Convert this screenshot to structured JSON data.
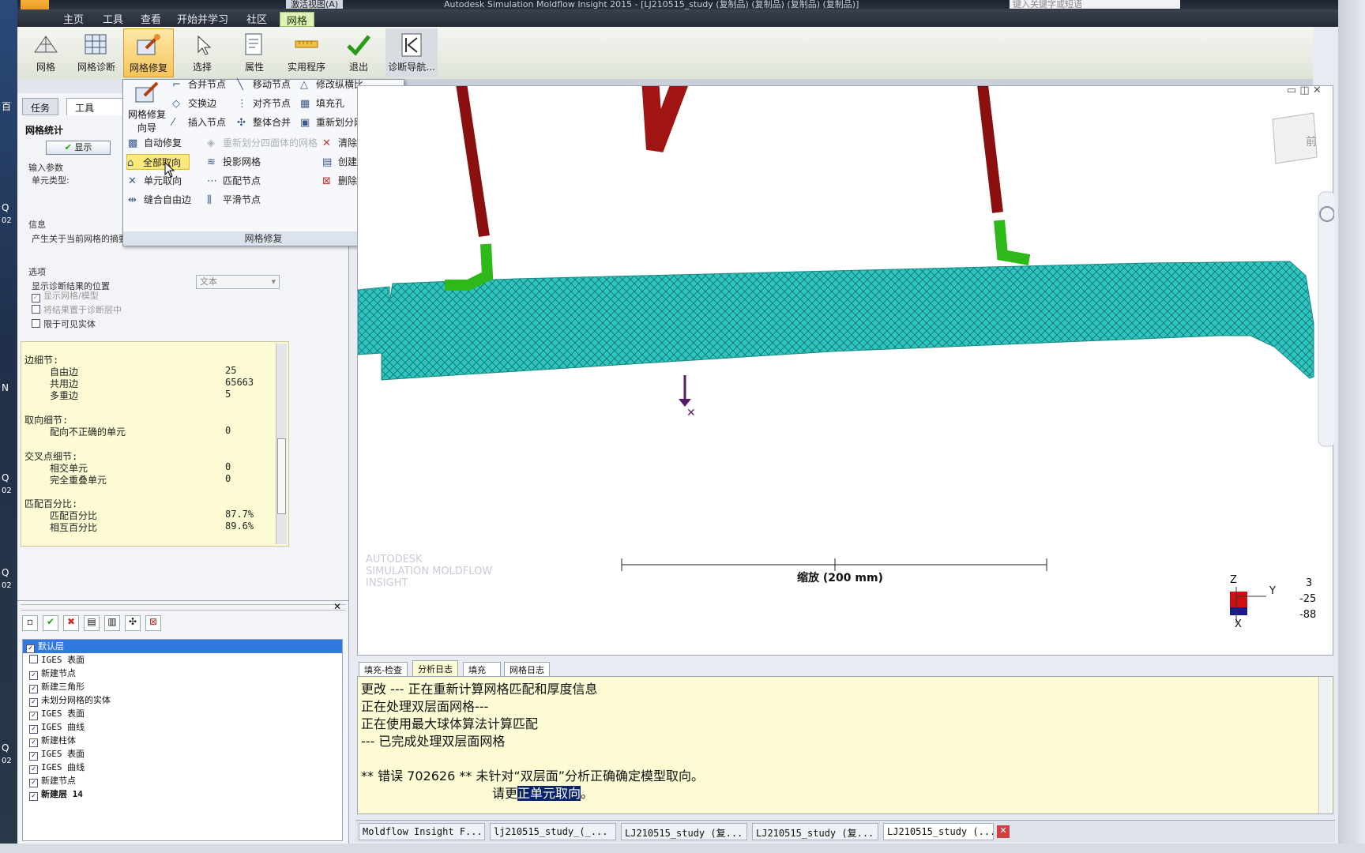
{
  "window": {
    "title": "Autodesk Simulation Moldflow Insight 2015 - [LJ210515_study (复制品) (复制品) (复制品) (复制品)]",
    "view_dropdown": "激活视图(A)",
    "search_placeholder": "键入关键字或短语"
  },
  "desktop_labels": [
    "百",
    "Q",
    "02",
    "N",
    "Q",
    "02",
    "Q",
    "02",
    "Q",
    "02"
  ],
  "menu": {
    "app_button": "MI",
    "items": [
      "主页",
      "工具",
      "查看",
      "开始并学习",
      "社区",
      "网格"
    ],
    "active": "网格"
  },
  "ribbon": {
    "buttons": [
      {
        "label": "网格",
        "icon": "mesh-icon"
      },
      {
        "label": "网格诊断",
        "icon": "mesh-diagnostic-icon"
      },
      {
        "label": "网格修复",
        "icon": "mesh-repair-icon",
        "selected": true
      },
      {
        "label": "选择",
        "icon": "cursor-select-icon"
      },
      {
        "label": "属性",
        "icon": "properties-icon"
      },
      {
        "label": "实用程序",
        "icon": "utilities-icon"
      },
      {
        "label": "退出",
        "icon": "checkmark-exit-icon"
      },
      {
        "label": "诊断导航...",
        "icon": "diagnostic-navigator-icon"
      }
    ]
  },
  "repair_menu": {
    "wizard_label_1": "网格修复",
    "wizard_label_2": "向导",
    "items": {
      "merge_nodes": "合并节点",
      "move_nodes": "移动节点",
      "modify_aspect": "修改纵横比",
      "swap_edge": "交换边",
      "align_nodes": "对齐节点",
      "fill_hole": "填充孔",
      "insert_node": "插入节点",
      "global_merge": "整体合并",
      "remesh": "重新划分网格",
      "auto_repair": "自动修复",
      "remesh_tetra": "重新划分四面体的网格",
      "purge_nodes": "清除节点",
      "orient_all": "全部取向",
      "project_mesh": "投影网格",
      "create_region": "创建区域",
      "orient_element": "单元取向",
      "match_nodes": "匹配节点",
      "delete_entity": "删除实体",
      "stitch_free_edges": "缝合自由边",
      "smooth_nodes": "平滑节点"
    },
    "footer": "网格修复"
  },
  "left_panel": {
    "tabs": [
      "任务",
      "工具"
    ],
    "section_title": "网格统计",
    "show_button": "显示",
    "input_params": "输入参数",
    "element_type": "单元类型:",
    "info_label": "信息",
    "info_text": "产生关于当前网格的摘要报告",
    "options_label": "选项",
    "display_location_label": "显示诊断结果的位置",
    "display_location_value": "文本",
    "opt_show_mesh": "显示网格/模型",
    "opt_place_layer": "将结果置于诊断层中",
    "opt_limit_visible": "限于可见实体"
  },
  "stats": {
    "edge_details": "边细节:",
    "free_edges_label": "自由边",
    "free_edges": "25",
    "shared_edges_label": "共用边",
    "shared_edges": "65663",
    "multi_edges_label": "多重边",
    "multi_edges": "5",
    "orient_details": "取向细节:",
    "misoriented_label": "配向不正确的单元",
    "misoriented": "0",
    "intersect_details": "交叉点细节:",
    "intersect_label": "相交单元",
    "intersect": "0",
    "overlap_label": "完全重叠单元",
    "overlap": "0",
    "match_pct_label": "匹配百分比:",
    "match_label": "匹配百分比",
    "match": "87.7%",
    "reciprocal_label": "相互百分比",
    "reciprocal": "89.6%"
  },
  "layers": [
    {
      "name": "默认层",
      "checked": true,
      "selected": true
    },
    {
      "name": "IGES 表面",
      "checked": false
    },
    {
      "name": "新建节点",
      "checked": true
    },
    {
      "name": "新建三角形",
      "checked": true
    },
    {
      "name": "未划分网格的实体",
      "checked": true
    },
    {
      "name": "IGES 表面",
      "checked": true
    },
    {
      "name": "IGES 曲线",
      "checked": true
    },
    {
      "name": "新建柱体",
      "checked": true
    },
    {
      "name": "IGES 表面",
      "checked": true
    },
    {
      "name": "IGES 曲线",
      "checked": true
    },
    {
      "name": "新建节点",
      "checked": true
    },
    {
      "name": "新建层  14",
      "checked": true,
      "bold": true
    }
  ],
  "viewport": {
    "watermark": [
      "AUTODESK",
      "SIMULATION MOLDFLOW",
      "INSIGHT"
    ],
    "scale_label": "缩放 (200 mm)",
    "axis_values": [
      "3",
      "-25",
      "-88"
    ],
    "axis_labels": {
      "z": "Z",
      "y": "Y",
      "x": "X"
    },
    "view_cube_label": "前"
  },
  "log_tabs": [
    "填充-检查",
    "分析日志",
    "填充",
    "网格日志"
  ],
  "log_lines": [
    "更改 --- 正在重新计算网格匹配和厚度信息",
    "正在处理双层面网格---",
    "正在使用最大球体算法计算匹配",
    "--- 已完成处理双层面网格",
    "",
    "** 错误 702626 ** 未针对“双层面”分析正确确定模型取向。"
  ],
  "log_last_prefix": "请更",
  "log_last_highlight": "正单元取向",
  "log_last_suffix": "。",
  "tasks": [
    "Moldflow Insight F...",
    "lj210515_study_(_...",
    "LJ210515_study (复...",
    "LJ210515_study (复...",
    "LJ210515_study (..."
  ],
  "colors": {
    "mesh": "#2ec4c0",
    "runner": "#8a1010",
    "gate": "#2fb81a",
    "ribbon_active": "#dff0b8",
    "log_bg": "#fdfbd4"
  }
}
